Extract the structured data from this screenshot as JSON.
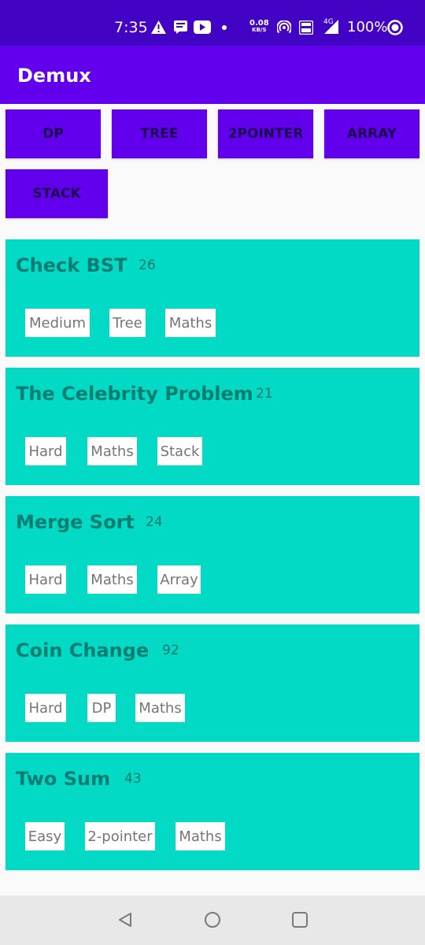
{
  "status_bar": {
    "time": "7:35",
    "speed_value": "0.08",
    "speed_unit": "KB/S",
    "network": "4G",
    "battery": "100%",
    "icons": [
      "alert-icon",
      "message-icon",
      "youtube-icon",
      "dot-icon",
      "hotspot-icon",
      "volte-icon",
      "signal-icon",
      "battery-icon"
    ]
  },
  "app_bar": {
    "title": "Demux"
  },
  "filters": [
    {
      "label": "DP"
    },
    {
      "label": "TREE"
    },
    {
      "label": "2POINTER"
    },
    {
      "label": "ARRAY"
    },
    {
      "label": "STACK"
    }
  ],
  "problems": [
    {
      "title": "Check BST",
      "count": "26",
      "tags": [
        "Medium",
        "Tree",
        "Maths"
      ]
    },
    {
      "title": "The Celebrity Problem",
      "count": "21",
      "tags": [
        "Hard",
        "Maths",
        "Stack"
      ]
    },
    {
      "title": "Merge Sort",
      "count": "24",
      "tags": [
        "Hard",
        "Maths",
        "Array"
      ]
    },
    {
      "title": "Coin Change",
      "count": "92",
      "tags": [
        "Hard",
        "DP",
        "Maths"
      ]
    },
    {
      "title": "Two Sum",
      "count": "43",
      "tags": [
        "Easy",
        "2-pointer",
        "Maths"
      ]
    }
  ],
  "nav_bar": {
    "icons": [
      "back-icon",
      "home-icon",
      "recents-icon"
    ]
  },
  "colors": {
    "status_bar": "#4203c5",
    "primary": "#6200ee",
    "card": "#03dac5",
    "card_text": "#017d72",
    "tag_bg": "#ffffff",
    "tag_text": "#757575"
  }
}
